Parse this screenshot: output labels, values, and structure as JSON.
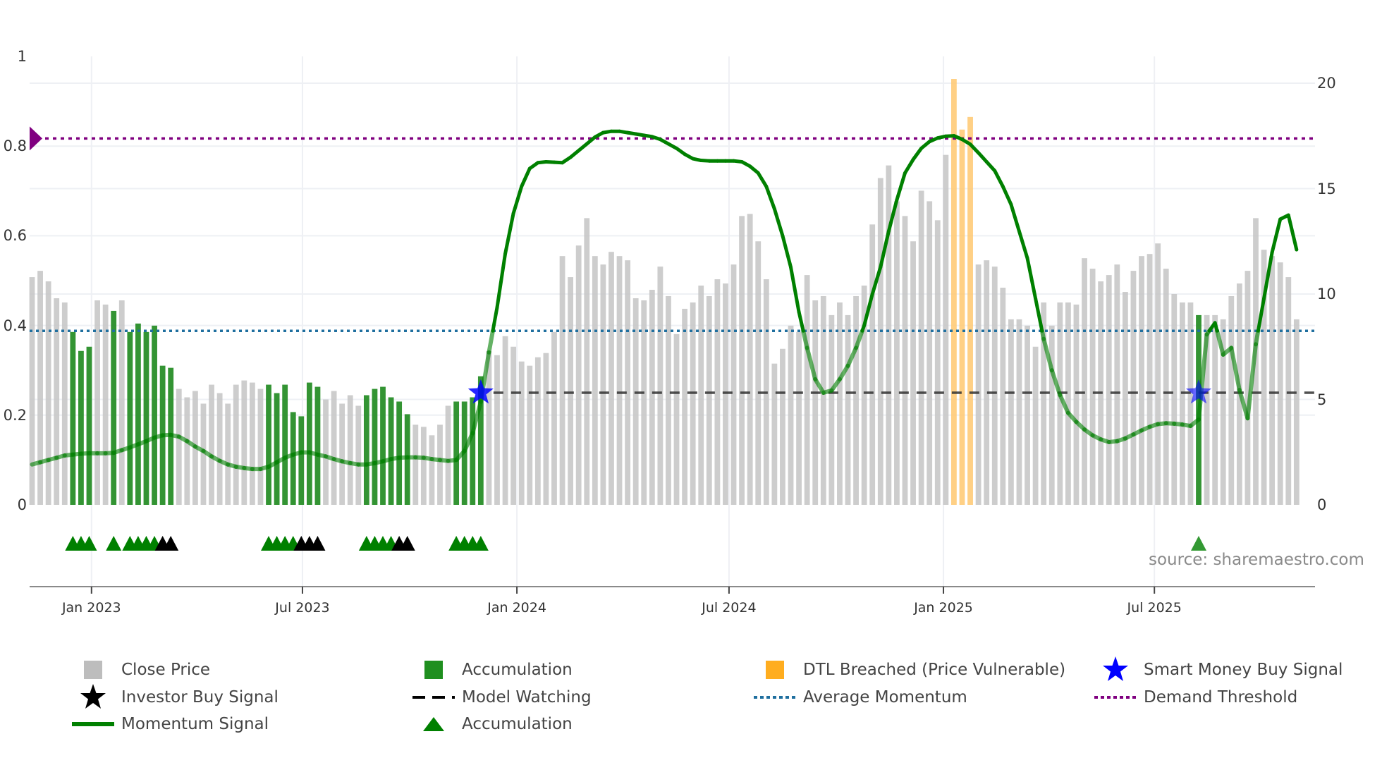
{
  "chart_data": {
    "type": "bar",
    "source_label": "source: sharemaestro.com",
    "left_axis": {
      "ticks": [
        "0",
        "0.2",
        "0.4",
        "0.6",
        "0.8",
        "1"
      ],
      "range": [
        0,
        1
      ]
    },
    "right_axis": {
      "ticks": [
        "0",
        "5",
        "10",
        "15",
        "20"
      ],
      "range": [
        0,
        21
      ]
    },
    "x_ticks": [
      {
        "label": "Jan 2023",
        "date": "2023-01-01"
      },
      {
        "label": "Jul 2023",
        "date": "2023-07-01"
      },
      {
        "label": "Jan 2024",
        "date": "2024-01-01"
      },
      {
        "label": "Jul 2024",
        "date": "2024-07-01"
      },
      {
        "label": "Jan 2025",
        "date": "2025-01-01"
      },
      {
        "label": "Jul 2025",
        "date": "2025-07-01"
      }
    ],
    "grid": true,
    "legend_placement": "bottom",
    "colors": {
      "close": "#c4c4c4",
      "accumulation": "#228b22",
      "dtl": "#ffc870",
      "momentum": "#008000",
      "average_momentum": "#1f6f9f",
      "demand_threshold": "#800080",
      "model_watching": "#333333",
      "smart_money": "#0000ff",
      "investor": "#000000"
    },
    "dates": [
      "2022-11-11",
      "2022-11-18",
      "2022-11-25",
      "2022-12-02",
      "2022-12-09",
      "2022-12-16",
      "2022-12-23",
      "2022-12-30",
      "2023-01-06",
      "2023-01-13",
      "2023-01-20",
      "2023-01-27",
      "2023-02-03",
      "2023-02-10",
      "2023-02-17",
      "2023-02-24",
      "2023-03-03",
      "2023-03-10",
      "2023-03-17",
      "2023-03-24",
      "2023-03-31",
      "2023-04-07",
      "2023-04-14",
      "2023-04-21",
      "2023-04-28",
      "2023-05-05",
      "2023-05-12",
      "2023-05-19",
      "2023-05-26",
      "2023-06-02",
      "2023-06-09",
      "2023-06-16",
      "2023-06-23",
      "2023-06-30",
      "2023-07-07",
      "2023-07-14",
      "2023-07-21",
      "2023-07-28",
      "2023-08-04",
      "2023-08-11",
      "2023-08-18",
      "2023-08-25",
      "2023-09-01",
      "2023-09-08",
      "2023-09-15",
      "2023-09-22",
      "2023-09-29",
      "2023-10-06",
      "2023-10-13",
      "2023-10-20",
      "2023-10-27",
      "2023-11-03",
      "2023-11-10",
      "2023-11-17",
      "2023-11-24",
      "2023-12-01",
      "2023-12-08",
      "2023-12-15",
      "2023-12-22",
      "2023-12-29",
      "2024-01-05",
      "2024-01-12",
      "2024-01-19",
      "2024-01-26",
      "2024-02-02",
      "2024-02-09",
      "2024-02-16",
      "2024-02-23",
      "2024-03-01",
      "2024-03-08",
      "2024-03-15",
      "2024-03-22",
      "2024-03-29",
      "2024-04-05",
      "2024-04-12",
      "2024-04-19",
      "2024-04-26",
      "2024-05-03",
      "2024-05-10",
      "2024-05-17",
      "2024-05-24",
      "2024-05-31",
      "2024-06-07",
      "2024-06-14",
      "2024-06-21",
      "2024-06-28",
      "2024-07-05",
      "2024-07-12",
      "2024-07-19",
      "2024-07-26",
      "2024-08-02",
      "2024-08-09",
      "2024-08-16",
      "2024-08-23",
      "2024-08-30",
      "2024-09-06",
      "2024-09-13",
      "2024-09-20",
      "2024-09-27",
      "2024-10-04",
      "2024-10-11",
      "2024-10-18",
      "2024-10-25",
      "2024-11-01",
      "2024-11-08",
      "2024-11-15",
      "2024-11-22",
      "2024-11-29",
      "2024-12-06",
      "2024-12-13",
      "2024-12-20",
      "2024-12-27",
      "2025-01-03",
      "2025-01-10",
      "2025-01-17",
      "2025-01-24",
      "2025-01-31",
      "2025-02-07",
      "2025-02-14",
      "2025-02-21",
      "2025-02-28",
      "2025-03-07",
      "2025-03-14",
      "2025-03-21",
      "2025-03-28",
      "2025-04-04",
      "2025-04-11",
      "2025-04-18",
      "2025-04-25",
      "2025-05-02",
      "2025-05-09",
      "2025-05-16",
      "2025-05-23",
      "2025-05-30",
      "2025-06-06",
      "2025-06-13",
      "2025-06-20",
      "2025-06-27",
      "2025-07-04",
      "2025-07-11",
      "2025-07-18",
      "2025-07-25",
      "2025-08-01",
      "2025-08-08",
      "2025-08-15",
      "2025-08-22",
      "2025-08-29",
      "2025-09-05",
      "2025-09-12",
      "2025-09-19",
      "2025-09-26",
      "2025-10-03",
      "2025-10-10",
      "2025-10-17",
      "2025-10-24",
      "2025-10-31"
    ],
    "close_price": [
      10.8,
      11.1,
      10.6,
      9.8,
      9.6,
      8.2,
      7.3,
      7.5,
      9.7,
      9.5,
      9.2,
      9.7,
      8.2,
      8.6,
      8.2,
      8.5,
      6.6,
      6.5,
      5.5,
      5.1,
      5.4,
      4.8,
      5.7,
      5.3,
      4.8,
      5.7,
      5.9,
      5.8,
      5.5,
      5.7,
      5.3,
      5.7,
      4.4,
      4.2,
      5.8,
      5.6,
      5.0,
      5.4,
      4.8,
      5.2,
      4.7,
      5.2,
      5.5,
      5.6,
      5.1,
      4.9,
      4.3,
      3.8,
      3.7,
      3.3,
      3.8,
      4.7,
      4.9,
      4.9,
      5.1,
      6.1,
      7.3,
      7.1,
      8.0,
      7.5,
      6.8,
      6.6,
      7.0,
      7.2,
      8.2,
      11.8,
      10.8,
      12.3,
      13.6,
      11.8,
      11.4,
      12.0,
      11.8,
      11.6,
      9.8,
      9.7,
      10.2,
      11.3,
      9.9,
      8.1,
      9.3,
      9.6,
      10.4,
      9.9,
      10.7,
      10.5,
      11.4,
      13.7,
      13.8,
      12.5,
      10.7,
      6.7,
      7.4,
      8.5,
      8.2,
      10.9,
      9.7,
      9.9,
      9.0,
      9.6,
      9.0,
      9.9,
      10.4,
      13.3,
      15.5,
      16.1,
      14.4,
      13.7,
      12.5,
      14.9,
      14.4,
      13.5,
      16.6,
      20.2,
      17.8,
      18.4,
      11.4,
      11.6,
      11.3,
      10.3,
      8.8,
      8.8,
      8.5,
      7.5,
      9.6,
      8.5,
      9.6,
      9.6,
      9.5,
      11.7,
      11.2,
      10.6,
      10.9,
      11.4,
      10.1,
      11.1,
      11.8,
      11.9,
      12.4,
      11.2,
      10.0,
      9.6,
      9.6,
      9.0,
      9.0,
      9.0,
      8.8,
      9.9,
      10.5,
      11.1,
      13.6,
      12.1,
      11.8,
      11.5,
      10.8,
      8.8
    ],
    "accumulation_dates": [
      "2022-12-16",
      "2022-12-23",
      "2022-12-30",
      "2023-01-20",
      "2023-02-03",
      "2023-02-10",
      "2023-02-17",
      "2023-02-24",
      "2023-03-03",
      "2023-03-10",
      "2023-06-02",
      "2023-06-09",
      "2023-06-16",
      "2023-06-23",
      "2023-06-30",
      "2023-07-07",
      "2023-07-14",
      "2023-08-25",
      "2023-09-01",
      "2023-09-08",
      "2023-09-15",
      "2023-09-22",
      "2023-09-29",
      "2023-11-10",
      "2023-11-17",
      "2023-11-24",
      "2023-12-01",
      "2025-08-08"
    ],
    "dtl_breached_dates": [
      "2025-01-10",
      "2025-01-17",
      "2025-01-24"
    ],
    "momentum": [
      0.09,
      0.095,
      0.1,
      0.105,
      0.11,
      0.112,
      0.114,
      0.115,
      0.115,
      0.115,
      0.116,
      0.122,
      0.128,
      0.135,
      0.142,
      0.15,
      0.155,
      0.156,
      0.152,
      0.142,
      0.13,
      0.12,
      0.108,
      0.098,
      0.09,
      0.085,
      0.082,
      0.08,
      0.08,
      0.085,
      0.095,
      0.105,
      0.112,
      0.117,
      0.117,
      0.112,
      0.108,
      0.102,
      0.097,
      0.093,
      0.09,
      0.09,
      0.093,
      0.097,
      0.102,
      0.105,
      0.106,
      0.106,
      0.105,
      0.102,
      0.1,
      0.098,
      0.1,
      0.12,
      0.16,
      0.23,
      0.34,
      0.44,
      0.56,
      0.65,
      0.71,
      0.75,
      0.763,
      0.765,
      0.764,
      0.763,
      0.775,
      0.79,
      0.805,
      0.82,
      0.83,
      0.833,
      0.833,
      0.83,
      0.827,
      0.824,
      0.821,
      0.815,
      0.805,
      0.795,
      0.782,
      0.772,
      0.768,
      0.767,
      0.767,
      0.767,
      0.767,
      0.765,
      0.755,
      0.74,
      0.71,
      0.66,
      0.6,
      0.53,
      0.43,
      0.35,
      0.28,
      0.25,
      0.255,
      0.28,
      0.31,
      0.35,
      0.4,
      0.47,
      0.53,
      0.61,
      0.68,
      0.74,
      0.77,
      0.795,
      0.81,
      0.818,
      0.822,
      0.823,
      0.815,
      0.804,
      0.785,
      0.765,
      0.745,
      0.71,
      0.67,
      0.61,
      0.55,
      0.46,
      0.37,
      0.3,
      0.245,
      0.205,
      0.185,
      0.168,
      0.155,
      0.146,
      0.14,
      0.142,
      0.148,
      0.157,
      0.166,
      0.174,
      0.18,
      0.182,
      0.181,
      0.179,
      0.176,
      0.19,
      0.38,
      0.406,
      0.335,
      0.35,
      0.256,
      0.193,
      0.358,
      0.46,
      0.563,
      0.637,
      0.646,
      0.569
    ],
    "average_momentum": 0.388,
    "demand_threshold": 0.817,
    "model_watching": {
      "value": 0.25,
      "from": "2023-12-01"
    },
    "smart_money_buy": [
      {
        "date": "2023-12-01",
        "value": 0.25
      },
      {
        "date": "2025-08-08",
        "value": 0.25
      }
    ],
    "accumulation_markers": [
      "2022-12-16",
      "2022-12-23",
      "2022-12-30",
      "2023-01-20",
      "2023-02-03",
      "2023-02-10",
      "2023-02-17",
      "2023-02-24",
      "2023-06-02",
      "2023-06-09",
      "2023-06-16",
      "2023-06-23",
      "2023-08-25",
      "2023-09-01",
      "2023-09-08",
      "2023-09-15",
      "2023-11-10",
      "2023-11-17",
      "2023-11-24",
      "2023-12-01",
      "2025-08-08"
    ],
    "investor_buy_markers": [
      "2023-03-03",
      "2023-03-10",
      "2023-06-30",
      "2023-07-07",
      "2023-07-14",
      "2023-09-22",
      "2023-09-29"
    ]
  },
  "legend": {
    "close_price": "Close Price",
    "accumulation_bar": "Accumulation",
    "dtl_breached": "DTL Breached (Price Vulnerable)",
    "smart_money": "Smart Money Buy Signal",
    "investor_buy": "Investor Buy Signal",
    "model_watching": "Model Watching",
    "average_momentum": "Average Momentum",
    "demand_threshold": "Demand Threshold",
    "momentum_signal": "Momentum Signal",
    "accumulation_marker": "Accumulation"
  }
}
